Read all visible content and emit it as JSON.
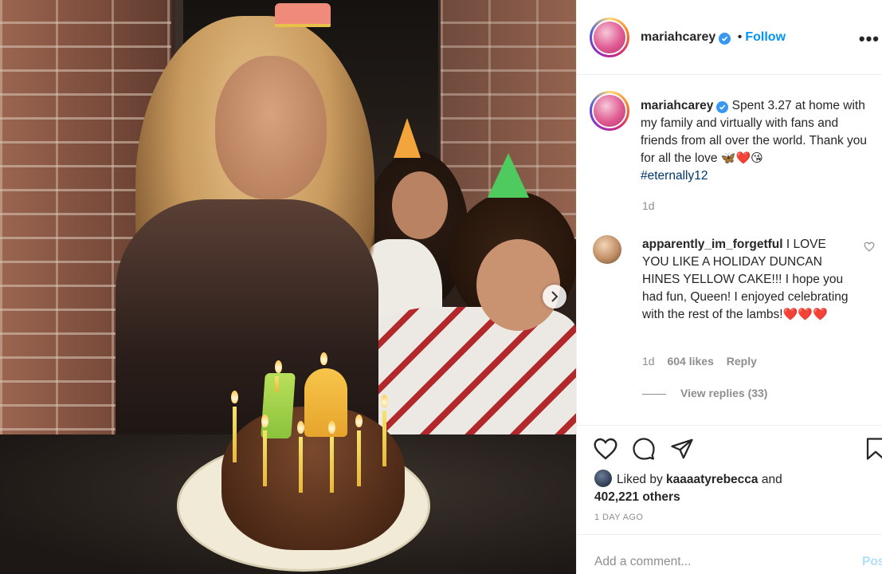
{
  "post": {
    "header": {
      "username": "mariahcarey",
      "separator": "•",
      "follow_label": "Follow",
      "more_label": "•••"
    },
    "caption": {
      "username": "mariahcarey",
      "text": "Spent 3.27 at home with my family and virtually with fans and friends from all over the world. Thank you for all the love",
      "emojis": "🦋❤️😘",
      "hashtag": "#eternally12",
      "age": "1d"
    },
    "comment": {
      "username": "apparently_im_forgetful",
      "text": "I LOVE YOU LIKE A HOLIDAY DUNCAN HINES YELLOW CAKE!!! I hope you had fun, Queen! I enjoyed celebrating with the rest of the lambs!",
      "emojis": "❤️❤️❤️",
      "age": "1d",
      "likes": "604 likes",
      "reply_label": "Reply",
      "view_replies": "View replies (33)"
    },
    "likes": {
      "prefix": "Liked by",
      "liker": "kaaaatyrebecca",
      "and": "and",
      "others": "402,221 others"
    },
    "date": "1 DAY AGO",
    "add_comment": {
      "placeholder": "Add a comment...",
      "post_label": "Post"
    }
  },
  "photo": {
    "cake_numbers": [
      "1",
      "2"
    ]
  },
  "colors": {
    "link": "#0095f6",
    "verified": "#3897f0",
    "muted": "#8e8e8e",
    "hashtag": "#00376b",
    "post_disabled": "#b2dffc"
  },
  "icons": [
    "verified-icon",
    "more-icon",
    "heart-icon",
    "comment-icon",
    "share-icon",
    "save-icon",
    "next-arrow-icon"
  ]
}
